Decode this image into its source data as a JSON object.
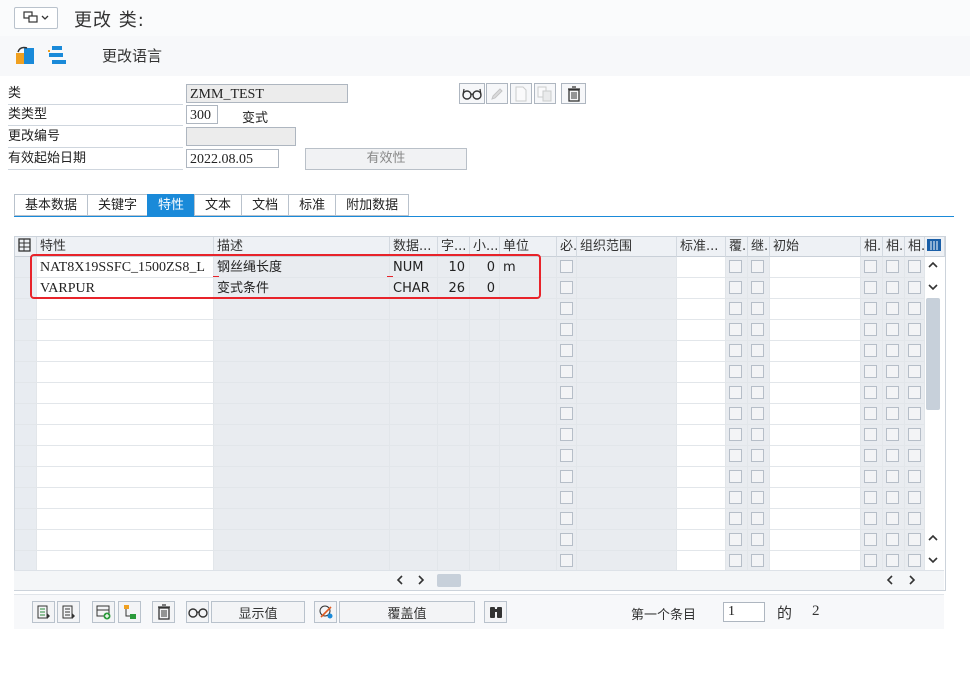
{
  "header": {
    "title": "更改 类:",
    "menu_icon": "menu-icon",
    "change_language": "更改语言"
  },
  "form": {
    "class_label": "类",
    "class_value": "ZMM_TEST",
    "class_type_label": "类类型",
    "class_type_value": "300",
    "class_type_desc": "变式",
    "change_number_label": "更改编号",
    "change_number_value": "",
    "valid_from_label": "有效起始日期",
    "valid_from_value": "2022.08.05",
    "validity_button": "有效性"
  },
  "tabs": [
    "基本数据",
    "关键字",
    "特性",
    "文本",
    "文档",
    "标准",
    "附加数据"
  ],
  "active_tab": "特性",
  "grid": {
    "headers": {
      "characteristic": "特性",
      "description": "描述",
      "data_type": "数据...",
      "chars": "字...",
      "decimals": "小...",
      "unit": "单位",
      "required": "必...",
      "org_area": "组织范围",
      "standard": "标准...",
      "overwrite": "覆...",
      "inherit": "继...",
      "initial": "初始",
      "rel1": "相...",
      "rel2": "相...",
      "rel3": "相..."
    },
    "rows": [
      {
        "characteristic": "NAT8X19SSFC_1500ZS8_L",
        "description": "钢丝绳长度",
        "data_type": "NUM",
        "chars": "10",
        "decimals": "0",
        "unit": "m"
      },
      {
        "characteristic": "VARPUR",
        "description": "变式条件",
        "data_type": "CHAR",
        "chars": "26",
        "decimals": "0",
        "unit": ""
      }
    ]
  },
  "bottom": {
    "display_values": "显示值",
    "overwrite_values": "覆盖值",
    "first_entry_label": "第一个条目",
    "first_entry_value": "1",
    "of_label": "的",
    "total": "2"
  },
  "colors": {
    "accent": "#1a8ad9",
    "highlight": "#e8232a"
  }
}
